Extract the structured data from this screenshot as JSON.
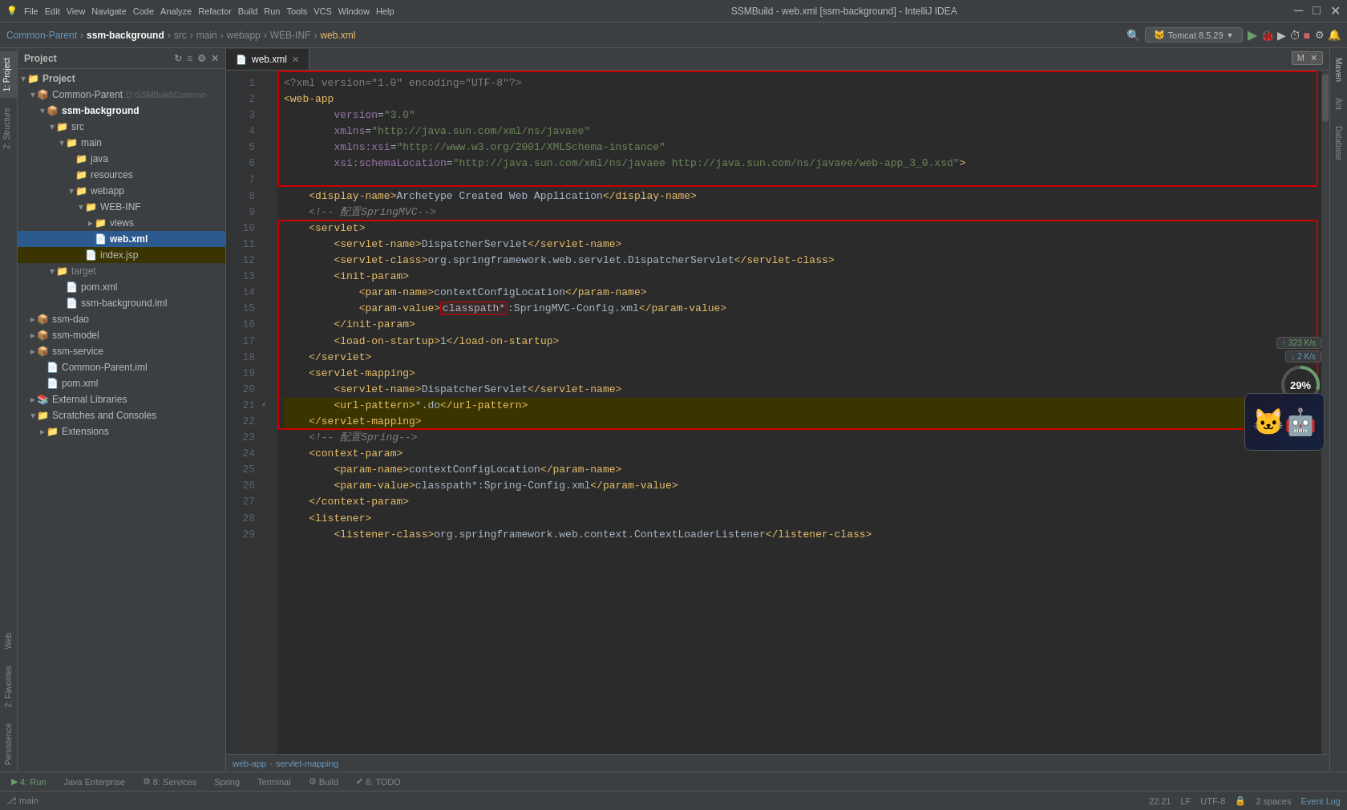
{
  "titlebar": {
    "title": "SSMBuild - web.xml [ssm-background] - IntelliJ IDEA",
    "min": "─",
    "max": "□",
    "close": "✕"
  },
  "menubar": {
    "items": [
      "File",
      "Edit",
      "View",
      "Navigate",
      "Code",
      "Analyze",
      "Refactor",
      "Build",
      "Run",
      "Tools",
      "VCS",
      "Window",
      "Help"
    ]
  },
  "toolbar": {
    "breadcrumbs": [
      "Common-Parent",
      "ssm-background",
      "src",
      "main",
      "webapp",
      "WEB-INF",
      "web.xml"
    ],
    "tomcat": "Tomcat 8.5.29",
    "percent": "29%",
    "speed_up": "↑ 323 K/s",
    "speed_down": "↓ 2 K/s"
  },
  "project": {
    "title": "Project",
    "tree": [
      {
        "indent": 0,
        "icon": "▾",
        "label": "Project",
        "type": "root"
      },
      {
        "indent": 1,
        "icon": "▾",
        "label": "Common-Parent",
        "path": "D:\\SSMBuild\\Common-",
        "type": "module"
      },
      {
        "indent": 2,
        "icon": "▾",
        "label": "ssm-background",
        "type": "module-bold"
      },
      {
        "indent": 3,
        "icon": "▾",
        "label": "src",
        "type": "folder"
      },
      {
        "indent": 4,
        "icon": "▾",
        "label": "main",
        "type": "folder"
      },
      {
        "indent": 5,
        "icon": "📁",
        "label": "java",
        "type": "folder-src"
      },
      {
        "indent": 5,
        "icon": "📁",
        "label": "resources",
        "type": "folder-res"
      },
      {
        "indent": 5,
        "icon": "▾",
        "label": "webapp",
        "type": "folder"
      },
      {
        "indent": 6,
        "icon": "▾",
        "label": "WEB-INF",
        "type": "folder"
      },
      {
        "indent": 7,
        "icon": "📁",
        "label": "views",
        "type": "folder"
      },
      {
        "indent": 7,
        "icon": "🔴",
        "label": "web.xml",
        "type": "file-xml",
        "selected": true
      },
      {
        "indent": 6,
        "icon": "📄",
        "label": "index.jsp",
        "type": "file-jsp"
      },
      {
        "indent": 3,
        "icon": "▾",
        "label": "target",
        "type": "folder"
      },
      {
        "indent": 4,
        "icon": "📄",
        "label": "pom.xml",
        "type": "file"
      },
      {
        "indent": 4,
        "icon": "📄",
        "label": "ssm-background.iml",
        "type": "file"
      },
      {
        "indent": 1,
        "icon": "▸",
        "label": "ssm-dao",
        "type": "module"
      },
      {
        "indent": 1,
        "icon": "▸",
        "label": "ssm-model",
        "type": "module"
      },
      {
        "indent": 1,
        "icon": "▸",
        "label": "ssm-service",
        "type": "module"
      },
      {
        "indent": 2,
        "icon": "📄",
        "label": "Common-Parent.iml",
        "type": "file"
      },
      {
        "indent": 2,
        "icon": "📄",
        "label": "pom.xml",
        "type": "file"
      },
      {
        "indent": 1,
        "icon": "▸",
        "label": "External Libraries",
        "type": "folder"
      },
      {
        "indent": 1,
        "icon": "▾",
        "label": "Scratches and Consoles",
        "type": "folder"
      },
      {
        "indent": 2,
        "icon": "▸",
        "label": "Extensions",
        "type": "folder"
      }
    ]
  },
  "editor": {
    "tab_label": "web.xml",
    "lines": [
      {
        "num": 1,
        "content": "<?xml version=\"1.0\" encoding=\"UTF-8\"?>"
      },
      {
        "num": 2,
        "content": "<web-app"
      },
      {
        "num": 3,
        "content": "        version=\"3.0\""
      },
      {
        "num": 4,
        "content": "        xmlns=\"http://java.sun.com/xml/ns/javaee\""
      },
      {
        "num": 5,
        "content": "        xmlns:xsi=\"http://www.w3.org/2001/XMLSchema-instance\""
      },
      {
        "num": 6,
        "content": "        xsi:schemaLocation=\"http://java.sun.com/xml/ns/javaee http://java.sun.com/ns/javaee/web-app_3_0.xsd\">"
      },
      {
        "num": 7,
        "content": ""
      },
      {
        "num": 8,
        "content": "    <display-name>Archetype Created Web Application</display-name>"
      },
      {
        "num": 9,
        "content": "    <!-- 配置SpringMVC-->"
      },
      {
        "num": 10,
        "content": "    <servlet>"
      },
      {
        "num": 11,
        "content": "        <servlet-name>DispatcherServlet</servlet-name>"
      },
      {
        "num": 12,
        "content": "        <servlet-class>org.springframework.web.servlet.DispatcherServlet</servlet-class>"
      },
      {
        "num": 13,
        "content": "        <init-param>"
      },
      {
        "num": 14,
        "content": "            <param-name>contextConfigLocation</param-name>"
      },
      {
        "num": 15,
        "content": "            <param-value>classpath*:SpringMVC-Config.xml</param-value>"
      },
      {
        "num": 16,
        "content": "        </init-param>"
      },
      {
        "num": 17,
        "content": "        <load-on-startup>1</load-on-startup>"
      },
      {
        "num": 18,
        "content": "    </servlet>"
      },
      {
        "num": 19,
        "content": "    <servlet-mapping>"
      },
      {
        "num": 20,
        "content": "        <servlet-name>DispatcherServlet</servlet-name>"
      },
      {
        "num": 21,
        "content": "        <url-pattern>*.do</url-pattern>"
      },
      {
        "num": 22,
        "content": "    </servlet-mapping>"
      },
      {
        "num": 23,
        "content": "    <!-- 配置Spring-->"
      },
      {
        "num": 24,
        "content": "    <context-param>"
      },
      {
        "num": 25,
        "content": "        <param-name>contextConfigLocation</param-name>"
      },
      {
        "num": 26,
        "content": "        <param-value>classpath*:Spring-Config.xml</param-value>"
      },
      {
        "num": 27,
        "content": "    </context-param>"
      },
      {
        "num": 28,
        "content": "    <listener>"
      },
      {
        "num": 29,
        "content": "        <listener-class>org.springframework.web.context.ContextLoaderListener</listener-class>"
      }
    ]
  },
  "editor_breadcrumb": {
    "items": [
      "web-app",
      "servlet-mapping"
    ]
  },
  "bottom_tabs": [
    {
      "label": "▶ 4: Run",
      "active": false
    },
    {
      "label": "Java Enterprise",
      "active": false
    },
    {
      "label": "⚙ 8: Services",
      "active": false
    },
    {
      "label": "Spring",
      "active": false
    },
    {
      "label": "Terminal",
      "active": false
    },
    {
      "label": "⚙ Build",
      "active": false
    },
    {
      "label": "✔ 6: TODO",
      "active": false
    }
  ],
  "statusbar": {
    "position": "22:21",
    "lf": "LF",
    "encoding": "UTF-8",
    "indent": "2 spaces",
    "event_log": "Event Log"
  },
  "right_sidebar": {
    "tabs": [
      "Maven",
      "Ant",
      "Database"
    ]
  },
  "left_sidebar": {
    "tabs": [
      "1: Project",
      "2: Structure",
      "Web",
      "2: Favorites",
      "Persistence"
    ]
  }
}
